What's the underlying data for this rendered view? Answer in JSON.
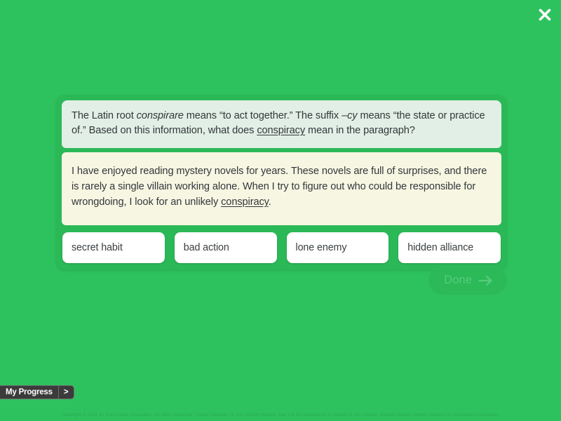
{
  "colors": {
    "background_green": "#2ec25e",
    "card_green": "#2bb958",
    "question_panel": "#e2efe6",
    "passage_panel": "#f7f6e3",
    "choice_white": "#ffffff",
    "done_disabled_bg": "#2cb957",
    "done_disabled_text": "#55cc80",
    "progress_tab": "#3b3b3b",
    "copyright_text": "#2aa953"
  },
  "close": {
    "icon": "close-icon",
    "label": "Close"
  },
  "question": {
    "part1": "The Latin root ",
    "root_italic": "conspirare",
    "part2": " means “to act together.” The suffix ",
    "suffix_italic": "–cy",
    "part3": " means “the state or practice of.” Based on this information, what does ",
    "underlined_word": "conspiracy",
    "part4": " mean in the paragraph?"
  },
  "passage": {
    "part1": "I have enjoyed reading mystery novels for years. These novels are full of surprises, and there is rarely a single villain working alone. When I try to figure out who could be responsible for wrongdoing, I look for an unlikely ",
    "underlined_word": "conspiracy",
    "part2": "."
  },
  "choices": [
    {
      "id": "A",
      "label": "secret habit",
      "selected": false
    },
    {
      "id": "B",
      "label": "bad action",
      "selected": false
    },
    {
      "id": "C",
      "label": "lone enemy",
      "selected": false
    },
    {
      "id": "D",
      "label": "hidden alliance",
      "selected": false
    }
  ],
  "done": {
    "label": "Done",
    "icon": "arrow-right-icon",
    "enabled": false
  },
  "progress": {
    "label": "My Progress",
    "expand_label": ">",
    "expand_icon": "chevron-right-icon"
  },
  "footer": {
    "copyright": "Copyright © 2021 by Curriculum Associates. All rights reserved. These materials, or any portion thereof, may not be reproduced or shared in any manner without express written consent of Curriculum Associates."
  }
}
